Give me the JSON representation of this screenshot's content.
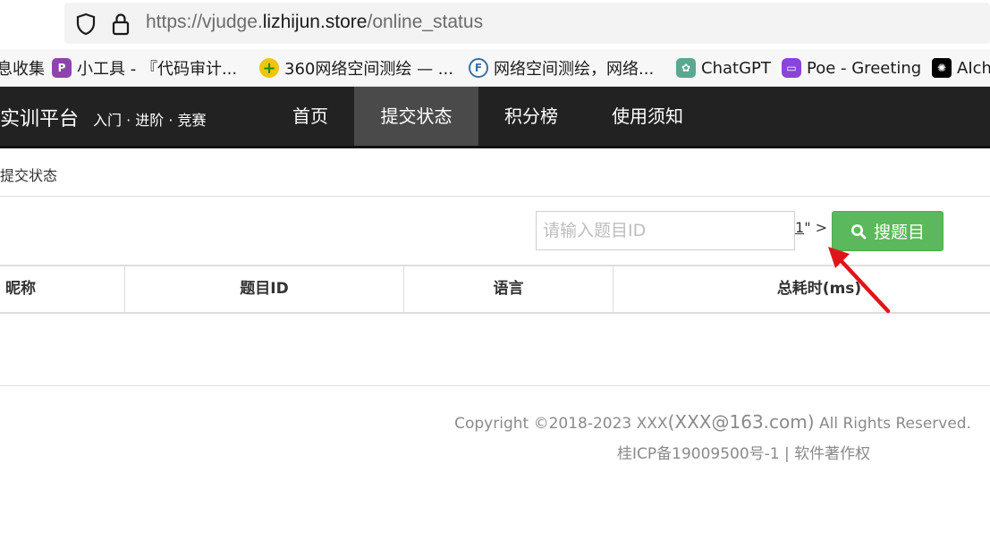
{
  "browser": {
    "url_prefix": "https://vjudge.",
    "url_host": "lizhijun.store",
    "url_path": "/online_status"
  },
  "bookmarks": [
    {
      "label": "息收集",
      "icon": "none"
    },
    {
      "label": "小工具 - 『代码审计...",
      "icon": "purple-p-icon",
      "color": "#8e44ad"
    },
    {
      "label": "360网络空间测绘 — ...",
      "icon": "360-icon",
      "color": "#2ca02c"
    },
    {
      "label": "网络空间测绘，网络...",
      "icon": "f-circle-icon",
      "color": "#3a6ea5"
    },
    {
      "label": "ChatGPT",
      "icon": "chatgpt-icon",
      "color": "#5aa890"
    },
    {
      "label": "Poe - Greeting",
      "icon": "poe-icon",
      "color": "#8a44d9"
    },
    {
      "label": "AIch",
      "icon": "openai-icon",
      "color": "#000000"
    }
  ],
  "nav": {
    "brand": "实训平台",
    "tagline": "入门 · 进阶 · 竞赛",
    "items": [
      "首页",
      "提交状态",
      "积分榜",
      "使用须知"
    ],
    "active_index": 1
  },
  "breadcrumb": "提交状态",
  "search": {
    "placeholder": "请输入题目ID",
    "pager_num": "1",
    "pager_rest": "\" >",
    "button_label": "搜题目"
  },
  "table": {
    "headers": [
      "昵称",
      "题目ID",
      "语言",
      "总耗时(ms)"
    ]
  },
  "footer": {
    "copyright_a": "Copyright ©2018-2023 XXX",
    "copyright_b": "(XXX@163.com)",
    "copyright_c": " All Rights Reserved.",
    "icp": "桂ICP备19009500号-1 | 软件著作权"
  },
  "colors": {
    "nav_bg": "#222222",
    "nav_active": "#4a4a4a",
    "button_green": "#5cb85c",
    "arrow_red": "#e0151b"
  }
}
